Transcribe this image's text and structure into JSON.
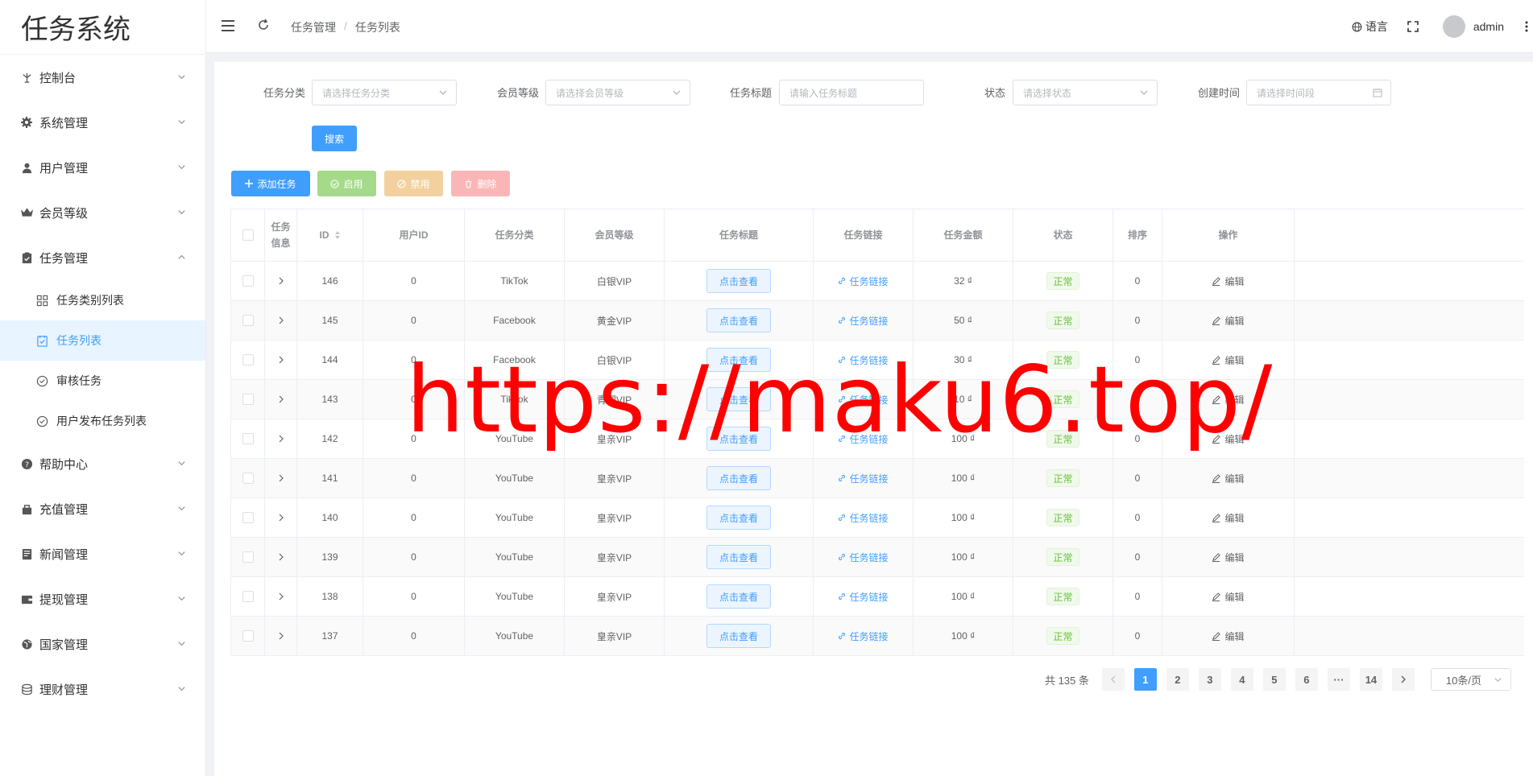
{
  "app": {
    "title": "任务系统"
  },
  "sidebar": {
    "items": [
      {
        "label": "控制台",
        "icon": "dashboard-icon"
      },
      {
        "label": "系统管理",
        "icon": "gear-icon"
      },
      {
        "label": "用户管理",
        "icon": "user-icon"
      },
      {
        "label": "会员等级",
        "icon": "crown-icon"
      },
      {
        "label": "任务管理",
        "icon": "clipboard-icon",
        "expanded": true
      }
    ],
    "sub_items": [
      {
        "label": "任务类别列表",
        "icon": "grid-icon"
      },
      {
        "label": "任务列表",
        "icon": "checklist-icon",
        "active": true
      },
      {
        "label": "审核任务",
        "icon": "check-circle-icon"
      },
      {
        "label": "用户发布任务列表",
        "icon": "check-circle-icon"
      }
    ],
    "items_after": [
      {
        "label": "帮助中心",
        "icon": "question-icon"
      },
      {
        "label": "充值管理",
        "icon": "bag-icon"
      },
      {
        "label": "新闻管理",
        "icon": "news-icon"
      },
      {
        "label": "提现管理",
        "icon": "wallet-icon"
      },
      {
        "label": "国家管理",
        "icon": "globe-icon"
      },
      {
        "label": "理财管理",
        "icon": "coins-icon"
      }
    ]
  },
  "header": {
    "breadcrumb": [
      "任务管理",
      "任务列表"
    ],
    "language_label": "语言",
    "username": "admin"
  },
  "filters": {
    "category": {
      "label": "任务分类",
      "placeholder": "请选择任务分类"
    },
    "level": {
      "label": "会员等级",
      "placeholder": "请选择会员等级"
    },
    "title": {
      "label": "任务标题",
      "placeholder": "请输入任务标题"
    },
    "status": {
      "label": "状态",
      "placeholder": "请选择状态"
    },
    "created": {
      "label": "创建时间",
      "placeholder": "请选择时间段"
    },
    "search_label": "搜索"
  },
  "toolbar": {
    "add_label": "添加任务",
    "enable_label": "启用",
    "disable_label": "禁用",
    "delete_label": "删除"
  },
  "table": {
    "headers": {
      "info_line1": "任务",
      "info_line2": "信息",
      "id": "ID",
      "user_id": "用户ID",
      "category": "任务分类",
      "level": "会员等级",
      "title": "任务标题",
      "link": "任务链接",
      "amount": "任务金额",
      "status": "状态",
      "sort": "排序",
      "actions": "操作"
    },
    "view_label": "点击查看",
    "link_label": "任务链接",
    "edit_label": "编辑",
    "rows": [
      {
        "id": "146",
        "user_id": "0",
        "category": "TikTok",
        "level": "白银VIP",
        "amount": "32 ₫",
        "status": "正常",
        "sort": "0"
      },
      {
        "id": "145",
        "user_id": "0",
        "category": "Facebook",
        "level": "黄金VIP",
        "amount": "50 ₫",
        "status": "正常",
        "sort": "0"
      },
      {
        "id": "144",
        "user_id": "0",
        "category": "Facebook",
        "level": "白银VIP",
        "amount": "30 ₫",
        "status": "正常",
        "sort": "0"
      },
      {
        "id": "143",
        "user_id": "0",
        "category": "TikTok",
        "level": "青铜VIP",
        "amount": "10 ₫",
        "status": "正常",
        "sort": "0"
      },
      {
        "id": "142",
        "user_id": "0",
        "category": "YouTube",
        "level": "皇亲VIP",
        "amount": "100 ₫",
        "status": "正常",
        "sort": "0"
      },
      {
        "id": "141",
        "user_id": "0",
        "category": "YouTube",
        "level": "皇亲VIP",
        "amount": "100 ₫",
        "status": "正常",
        "sort": "0"
      },
      {
        "id": "140",
        "user_id": "0",
        "category": "YouTube",
        "level": "皇亲VIP",
        "amount": "100 ₫",
        "status": "正常",
        "sort": "0"
      },
      {
        "id": "139",
        "user_id": "0",
        "category": "YouTube",
        "level": "皇亲VIP",
        "amount": "100 ₫",
        "status": "正常",
        "sort": "0"
      },
      {
        "id": "138",
        "user_id": "0",
        "category": "YouTube",
        "level": "皇亲VIP",
        "amount": "100 ₫",
        "status": "正常",
        "sort": "0"
      },
      {
        "id": "137",
        "user_id": "0",
        "category": "YouTube",
        "level": "皇亲VIP",
        "amount": "100 ₫",
        "status": "正常",
        "sort": "0"
      }
    ]
  },
  "pagination": {
    "total_text": "共 135 条",
    "pages": [
      "1",
      "2",
      "3",
      "4",
      "5",
      "6",
      "···",
      "14"
    ],
    "current": "1",
    "page_size": "10条/页"
  },
  "watermark": "https://maku6.top/",
  "colors": {
    "primary": "#409eff",
    "success": "#67c23a",
    "success_light": "#a4da89",
    "warning_light": "#f3d19e",
    "danger_light": "#fab6b6",
    "watermark": "#ff0000"
  }
}
